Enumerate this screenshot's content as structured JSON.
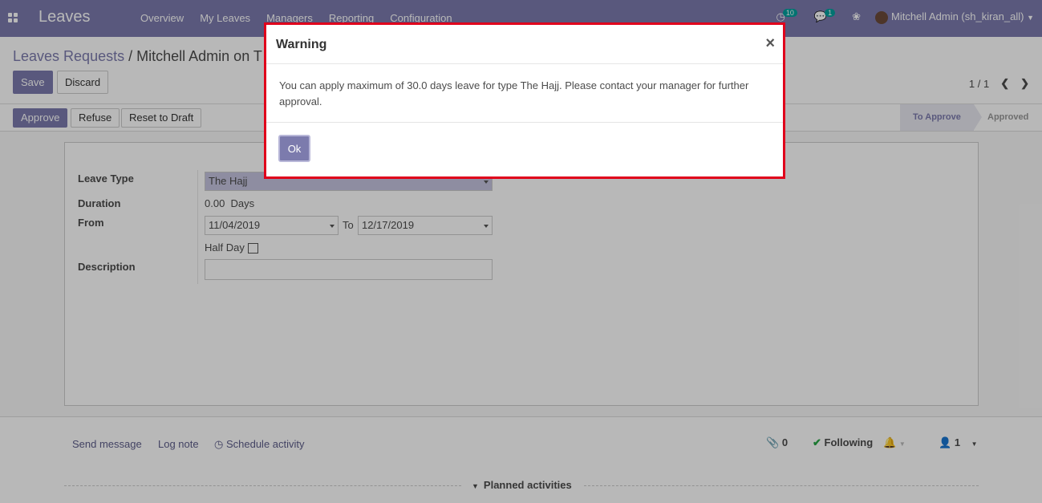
{
  "navbar": {
    "app_title": "Leaves",
    "menu": [
      "Overview",
      "My Leaves",
      "Managers",
      "Reporting",
      "Configuration"
    ],
    "activity_count": "10",
    "message_count": "1",
    "user_name": "Mitchell Admin (sh_kiran_all)"
  },
  "breadcrumb": {
    "parent": "Leaves Requests",
    "separator": "/",
    "current": "Mitchell Admin on T"
  },
  "buttons": {
    "save": "Save",
    "discard": "Discard",
    "approve": "Approve",
    "refuse": "Refuse",
    "reset": "Reset to Draft"
  },
  "pager": {
    "value": "1 / 1"
  },
  "stages": {
    "active": "To Approve",
    "next": "Approved"
  },
  "form": {
    "leave_type_label": "Leave Type",
    "leave_type_value": "The Hajj",
    "duration_label": "Duration",
    "duration_value": "0.00",
    "duration_unit": "Days",
    "from_label": "From",
    "from_date": "11/04/2019",
    "to_label": "To",
    "to_date": "12/17/2019",
    "half_day_label": "Half Day",
    "description_label": "Description",
    "description_value": ""
  },
  "chatter": {
    "send_message": "Send message",
    "log_note": "Log note",
    "schedule_activity": "Schedule activity",
    "attachments": "0",
    "following": "Following",
    "followers": "1",
    "planned": "Planned activities"
  },
  "modal": {
    "title": "Warning",
    "close": "×",
    "message": "You can apply maximum of 30.0 days leave for type The Hajj. Please contact your manager for further approval.",
    "ok": "Ok"
  },
  "colors": {
    "brand": "#7c7bad",
    "highlight_border": "#e0001b"
  }
}
